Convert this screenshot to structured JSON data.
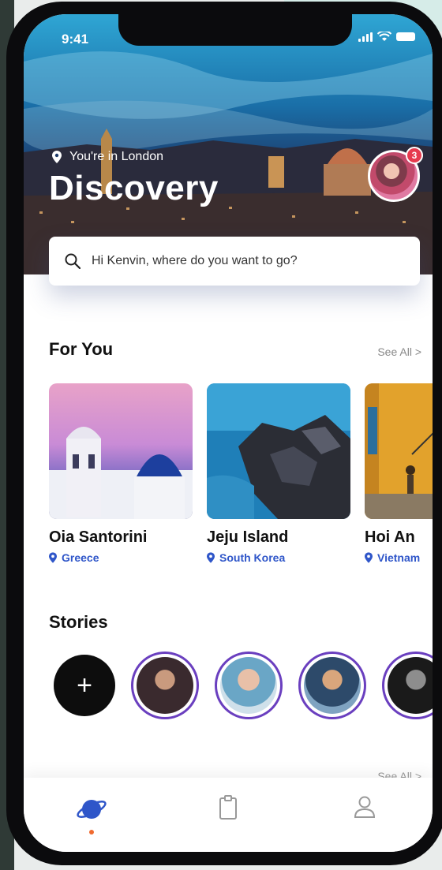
{
  "status_bar": {
    "time": "9:41"
  },
  "hero": {
    "location": "You're in London",
    "title": "Discovery",
    "notification_count": "3"
  },
  "search": {
    "placeholder": "Hi Kenvin, where do you want to go?"
  },
  "for_you": {
    "title": "For You",
    "see_all": "See All >",
    "cards": [
      {
        "name": "Oia Santorini",
        "country": "Greece"
      },
      {
        "name": "Jeju Island",
        "country": "South Korea"
      },
      {
        "name": "Hoi An",
        "country": "Vietnam"
      }
    ]
  },
  "stories": {
    "title": "Stories",
    "add_label": "+"
  },
  "next_section": {
    "see_all": "See All >"
  },
  "tab_bar": {
    "items": [
      "explore",
      "trips",
      "profile"
    ],
    "active": "explore"
  },
  "colors": {
    "accent": "#2f56c9",
    "badge": "#e63b4e",
    "story_ring": "#6a3fbf",
    "active_dot": "#f06a2f"
  }
}
